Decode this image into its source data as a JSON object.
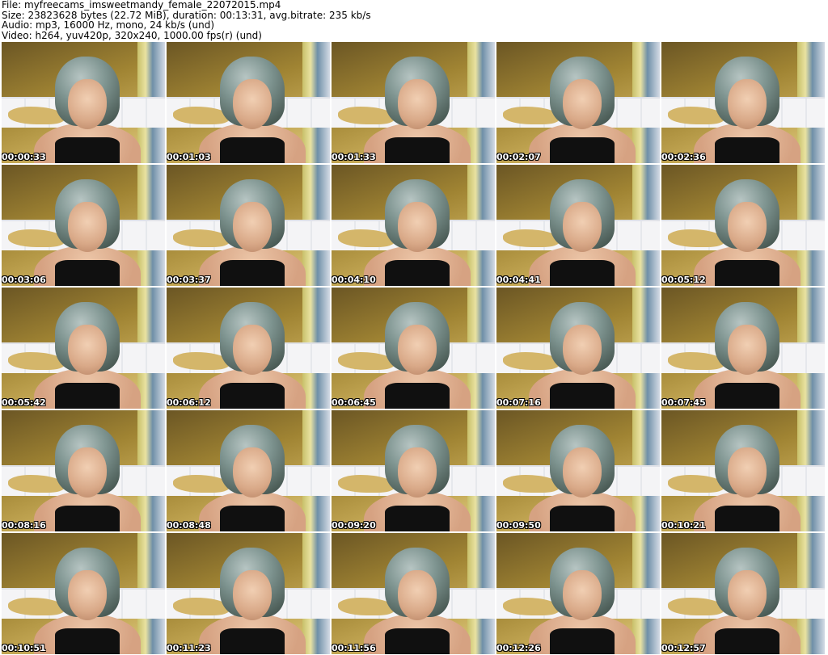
{
  "header": {
    "file": "File: myfreecams_imsweetmandy_female_22072015.mp4",
    "size": "Size: 23823628 bytes (22.72 MiB), duration: 00:13:31, avg.bitrate: 235 kb/s",
    "audio": "Audio: mp3, 16000 Hz, mono, 24 kb/s (und)",
    "video": "Video: h264, yuv420p, 320x240, 1000.00 fps(r) (und)"
  },
  "thumbnails": [
    {
      "timestamp": "00:00:33"
    },
    {
      "timestamp": "00:01:03"
    },
    {
      "timestamp": "00:01:33"
    },
    {
      "timestamp": "00:02:07"
    },
    {
      "timestamp": "00:02:36"
    },
    {
      "timestamp": "00:03:06"
    },
    {
      "timestamp": "00:03:37"
    },
    {
      "timestamp": "00:04:10"
    },
    {
      "timestamp": "00:04:41"
    },
    {
      "timestamp": "00:05:12"
    },
    {
      "timestamp": "00:05:42"
    },
    {
      "timestamp": "00:06:12"
    },
    {
      "timestamp": "00:06:45"
    },
    {
      "timestamp": "00:07:16"
    },
    {
      "timestamp": "00:07:45"
    },
    {
      "timestamp": "00:08:16"
    },
    {
      "timestamp": "00:08:48"
    },
    {
      "timestamp": "00:09:20"
    },
    {
      "timestamp": "00:09:50"
    },
    {
      "timestamp": "00:10:21"
    },
    {
      "timestamp": "00:10:51"
    },
    {
      "timestamp": "00:11:23"
    },
    {
      "timestamp": "00:11:56"
    },
    {
      "timestamp": "00:12:26"
    },
    {
      "timestamp": "00:12:57"
    }
  ]
}
